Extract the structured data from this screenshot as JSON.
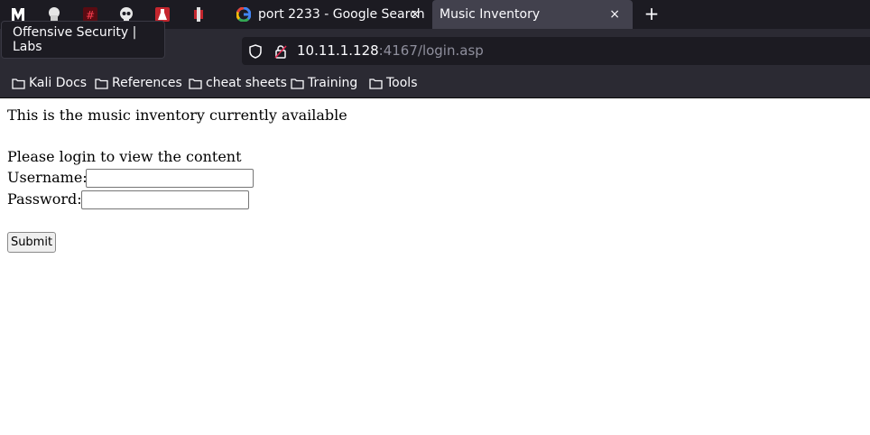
{
  "browser": {
    "tooltip": "Offensive Security | Labs",
    "tabs": [
      {
        "label": "port 2233 - Google Search",
        "active": false
      },
      {
        "label": "Music Inventory",
        "active": true
      }
    ],
    "url": {
      "host": "10.11.1.128",
      "path": ":4167/login.asp"
    },
    "bookmarks": [
      "Kali Docs",
      "References",
      "cheat sheets",
      "Training",
      "Tools"
    ],
    "close_glyph": "×",
    "new_tab_glyph": "+"
  },
  "page": {
    "intro": "This is the music inventory currently available",
    "prompt": "Please login to view the content",
    "username_label": "Username:",
    "password_label": "Password:",
    "username_value": "",
    "password_value": "",
    "submit_label": "Submit"
  }
}
